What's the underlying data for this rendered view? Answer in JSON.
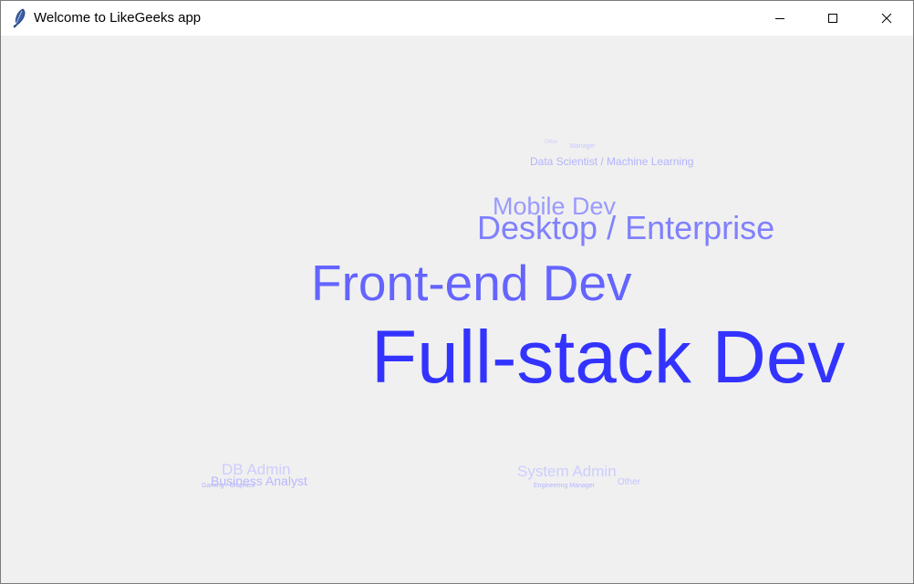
{
  "window": {
    "title": "Welcome to LikeGeeks app",
    "controls": {
      "minimize": "—",
      "maximize": "☐",
      "close": "✕"
    },
    "icon": "feather-icon"
  },
  "word_cloud": {
    "words": [
      {
        "text": "Full-stack Dev",
        "color": "#3333ff"
      },
      {
        "text": "Front-end Dev",
        "color": "#6464ff"
      },
      {
        "text": "Desktop / Enterprise",
        "color": "#8080ff"
      },
      {
        "text": "Mobile Dev",
        "color": "#9a9aff"
      },
      {
        "text": "Data Scientist / Machine Learning",
        "color": "#b4b4ff"
      },
      {
        "text": "Other",
        "color": "#cfcfff"
      },
      {
        "text": "Manager",
        "color": "#c8c8ff"
      },
      {
        "text": "DB Admin",
        "color": "#cdcdff"
      },
      {
        "text": "Business Analyst",
        "color": "#b8b8ff"
      },
      {
        "text": "Gaming / Graphics",
        "color": "#b4b4ff"
      },
      {
        "text": "System Admin",
        "color": "#cdcdff"
      },
      {
        "text": "Other",
        "color": "#c4c4ff"
      },
      {
        "text": "Engineering Manager",
        "color": "#b4b4ff"
      }
    ]
  }
}
